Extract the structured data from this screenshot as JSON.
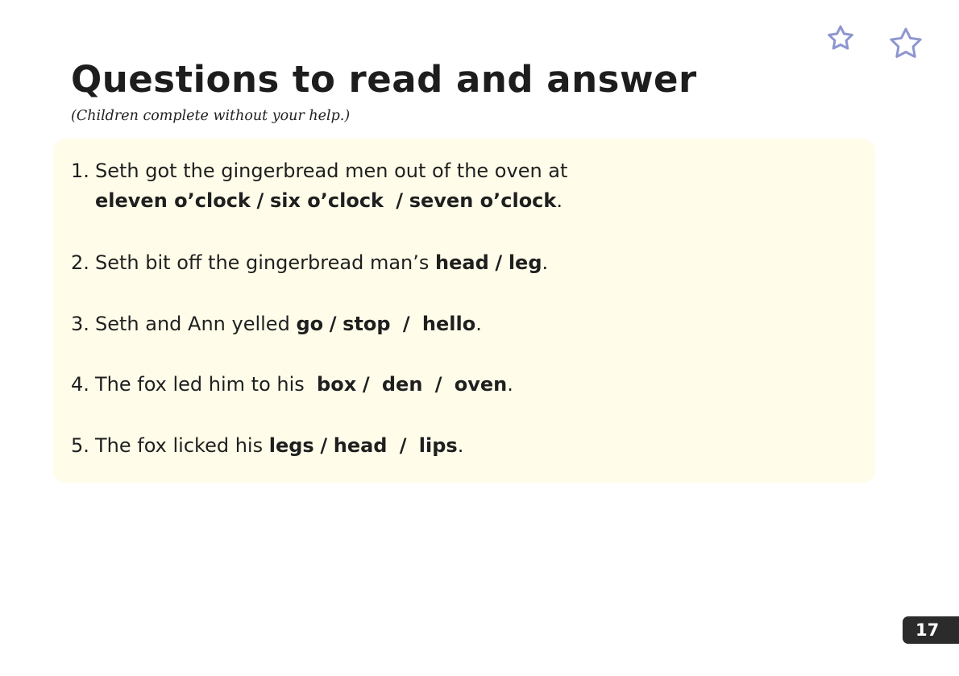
{
  "page": {
    "title": "Questions to read and answer",
    "subtitle": "(Children complete without your help.)",
    "page_number": "17",
    "star_color": "#8e96cf",
    "panel_color": "#fffdea"
  },
  "questions": [
    {
      "number": "1.",
      "text": "Seth got the gingerbread men out of the oven at",
      "options": [
        "eleven o’clock",
        "six o’clock",
        "seven o’clock"
      ]
    },
    {
      "number": "2.",
      "text": "Seth bit off the gingerbread man’s",
      "options": [
        "head",
        "leg"
      ]
    },
    {
      "number": "3.",
      "text": "Seth and Ann yelled",
      "options": [
        "go",
        "stop",
        "hello"
      ]
    },
    {
      "number": "4.",
      "text": "The fox led him to his",
      "options": [
        "box",
        "den",
        "oven"
      ]
    },
    {
      "number": "5.",
      "text": "The fox licked his",
      "options": [
        "legs",
        "head",
        "lips"
      ]
    }
  ],
  "separator": "/",
  "end_punct": "."
}
